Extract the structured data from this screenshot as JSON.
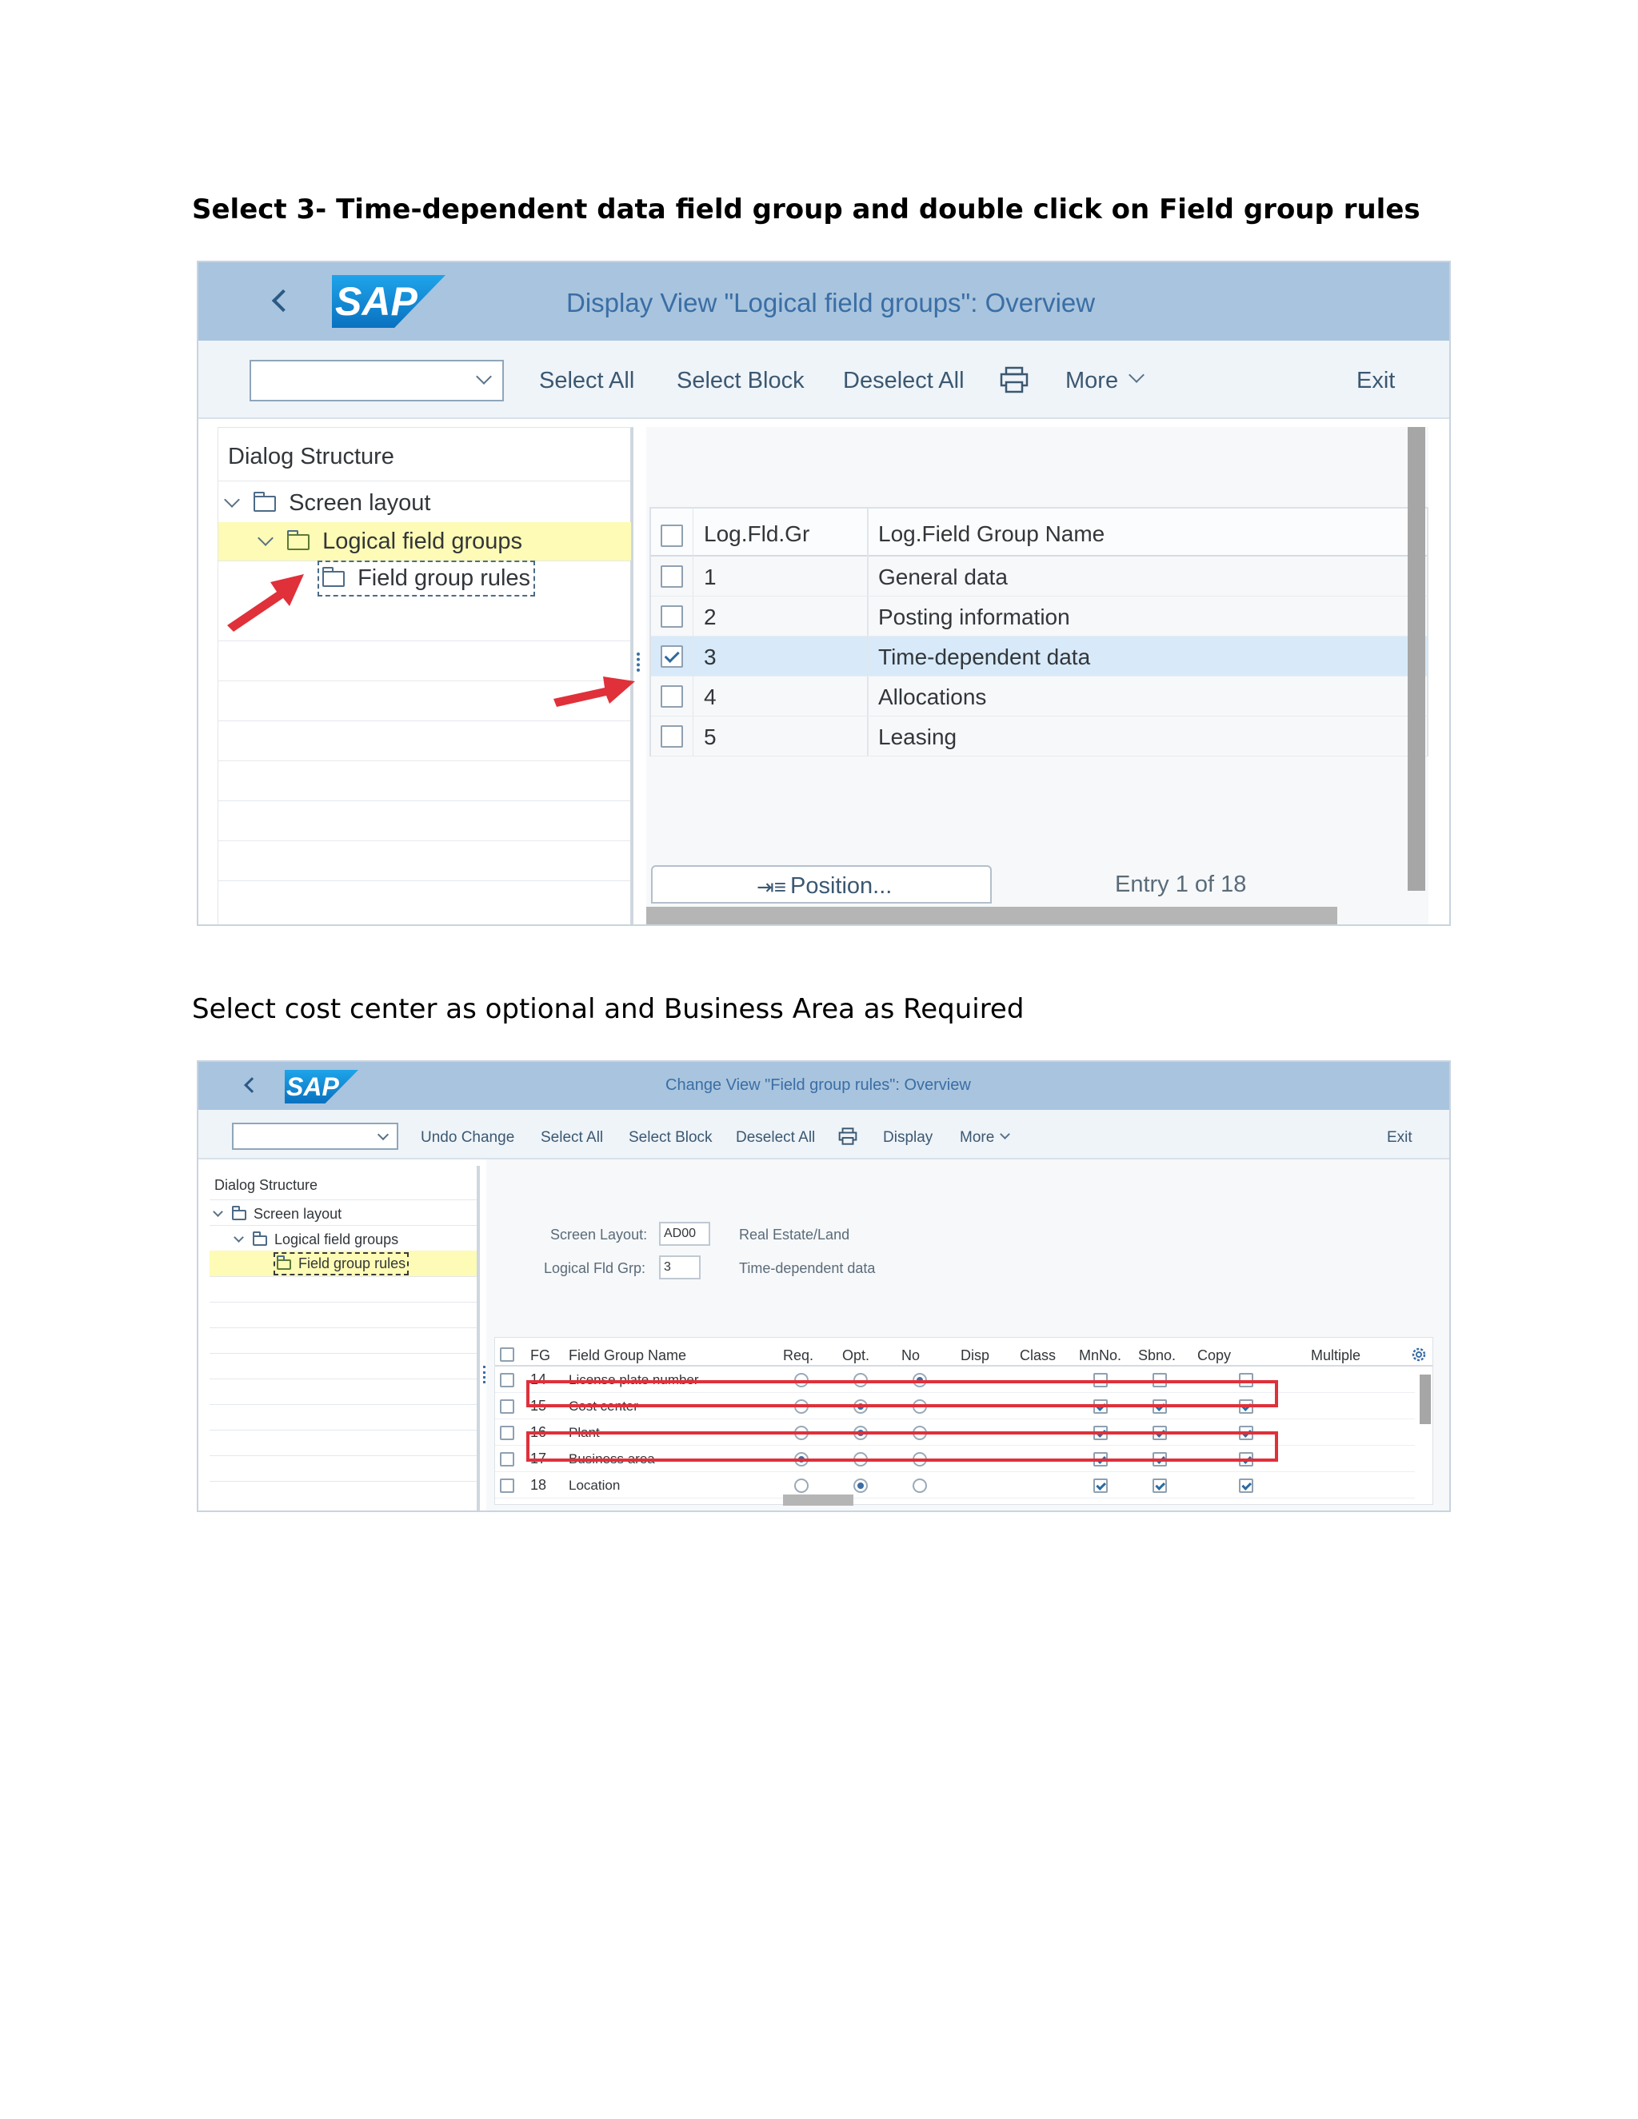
{
  "instructions": {
    "step1": "Select 3- Time-dependent data field group and double click on Field group rules",
    "step2": "Select cost center as optional and Business Area as Required"
  },
  "screen1": {
    "title": "Display View \"Logical field groups\": Overview",
    "toolbar": {
      "select_all": "Select All",
      "select_block": "Select Block",
      "deselect_all": "Deselect All",
      "more": "More",
      "exit": "Exit"
    },
    "dialog_structure": "Dialog Structure",
    "tree": {
      "screen_layout": "Screen layout",
      "logical_field_groups": "Logical field groups",
      "field_group_rules": "Field group rules"
    },
    "table": {
      "col1": "Log.Fld.Gr",
      "col2": "Log.Field Group Name",
      "rows": [
        {
          "id": "1",
          "name": "General data",
          "checked": false
        },
        {
          "id": "2",
          "name": "Posting information",
          "checked": false
        },
        {
          "id": "3",
          "name": "Time-dependent data",
          "checked": true
        },
        {
          "id": "4",
          "name": "Allocations",
          "checked": false
        },
        {
          "id": "5",
          "name": "Leasing",
          "checked": false
        }
      ]
    },
    "position_button": "Position...",
    "entry": "Entry 1 of 18"
  },
  "screen2": {
    "title": "Change View \"Field group rules\": Overview",
    "toolbar": {
      "undo_change": "Undo Change",
      "select_all": "Select All",
      "select_block": "Select Block",
      "deselect_all": "Deselect All",
      "display": "Display",
      "more": "More",
      "exit": "Exit"
    },
    "dialog_structure": "Dialog Structure",
    "tree": {
      "screen_layout": "Screen layout",
      "logical_field_groups": "Logical field groups",
      "field_group_rules": "Field group rules"
    },
    "form": {
      "screen_layout_label": "Screen Layout:",
      "screen_layout_value": "AD00",
      "screen_layout_desc": "Real Estate/Land",
      "logical_fld_grp_label": "Logical Fld Grp:",
      "logical_fld_grp_value": "3",
      "logical_fld_grp_desc": "Time-dependent data"
    },
    "table": {
      "headers": {
        "fg": "FG",
        "name": "Field Group Name",
        "req": "Req.",
        "opt": "Opt.",
        "no": "No",
        "disp": "Disp",
        "class": "Class",
        "mnno": "MnNo.",
        "sbno": "Sbno.",
        "copy": "Copy",
        "multiple": "Multiple"
      },
      "rows": [
        {
          "fg": "14",
          "name": "License plate number",
          "status": "no",
          "mnno": false,
          "sbno": false,
          "copy": false
        },
        {
          "fg": "15",
          "name": "Cost center",
          "status": "opt",
          "mnno": true,
          "sbno": true,
          "copy": true
        },
        {
          "fg": "16",
          "name": "Plant",
          "status": "opt",
          "mnno": true,
          "sbno": true,
          "copy": true
        },
        {
          "fg": "17",
          "name": "Business area",
          "status": "req",
          "mnno": true,
          "sbno": true,
          "copy": true
        },
        {
          "fg": "18",
          "name": "Location",
          "status": "opt",
          "mnno": true,
          "sbno": true,
          "copy": true
        }
      ]
    }
  },
  "colors": {
    "header_bg": "#a9c4de",
    "toolbar_bg": "#eff4f9",
    "highlight": "#fdfbb5",
    "selected_row": "#d8eaf9",
    "annotation_red": "#e0303a"
  }
}
